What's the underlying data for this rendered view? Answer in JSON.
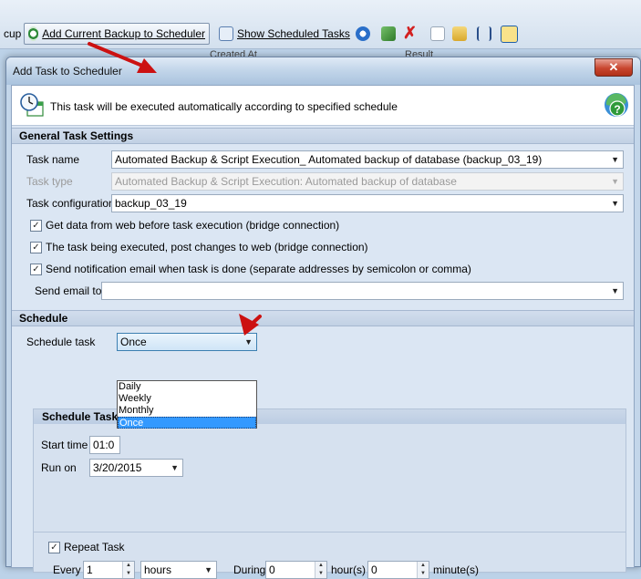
{
  "toolbar": {
    "partial_label": "cup",
    "add_backup_label": "Add Current Backup to Scheduler",
    "show_tasks_label": "Show Scheduled Tasks"
  },
  "background_grid": {
    "col_created": "Created At",
    "col_result": "Result"
  },
  "dialog": {
    "title": "Add Task to Scheduler",
    "close_glyph": "✕",
    "info_text": "This task will be executed automatically according to specified schedule",
    "general_section": "General Task Settings",
    "task_name_label": "Task name",
    "task_name_value": "Automated Backup & Script Execution_ Automated backup of database (backup_03_19)",
    "task_type_label": "Task type",
    "task_type_value": "Automated Backup & Script Execution: Automated backup of database",
    "task_config_label": "Task configuration",
    "task_config_value": "backup_03_19",
    "chk_get_data": "Get data from web before task execution (bridge connection)",
    "chk_post_changes": "The task being executed, post changes to web (bridge connection)",
    "chk_send_email": "Send notification email when task is done (separate addresses by semicolon or comma)",
    "send_email_label": "Send email to",
    "send_email_value": "",
    "schedule_section": "Schedule",
    "schedule_task_label": "Schedule task",
    "schedule_task_value": "Once",
    "schedule_options": [
      "Daily",
      "Weekly",
      "Monthly",
      "Once"
    ],
    "schedule_group_title": "Schedule Task",
    "start_time_label": "Start time",
    "start_time_value": "01:0",
    "run_on_label": "Run on",
    "run_on_value": "3/20/2015",
    "repeat_label": "Repeat Task",
    "every_label": "Every",
    "every_value": "1",
    "every_unit": "hours",
    "during_label": "During",
    "during_hours_value": "0",
    "hours_label": "hour(s)",
    "during_minutes_value": "0",
    "minutes_label": "minute(s)",
    "check_glyph": "✓",
    "arrow_glyph": "▼"
  },
  "colors": {
    "accent_red": "#cc1111",
    "selection_blue": "#3399ff"
  }
}
